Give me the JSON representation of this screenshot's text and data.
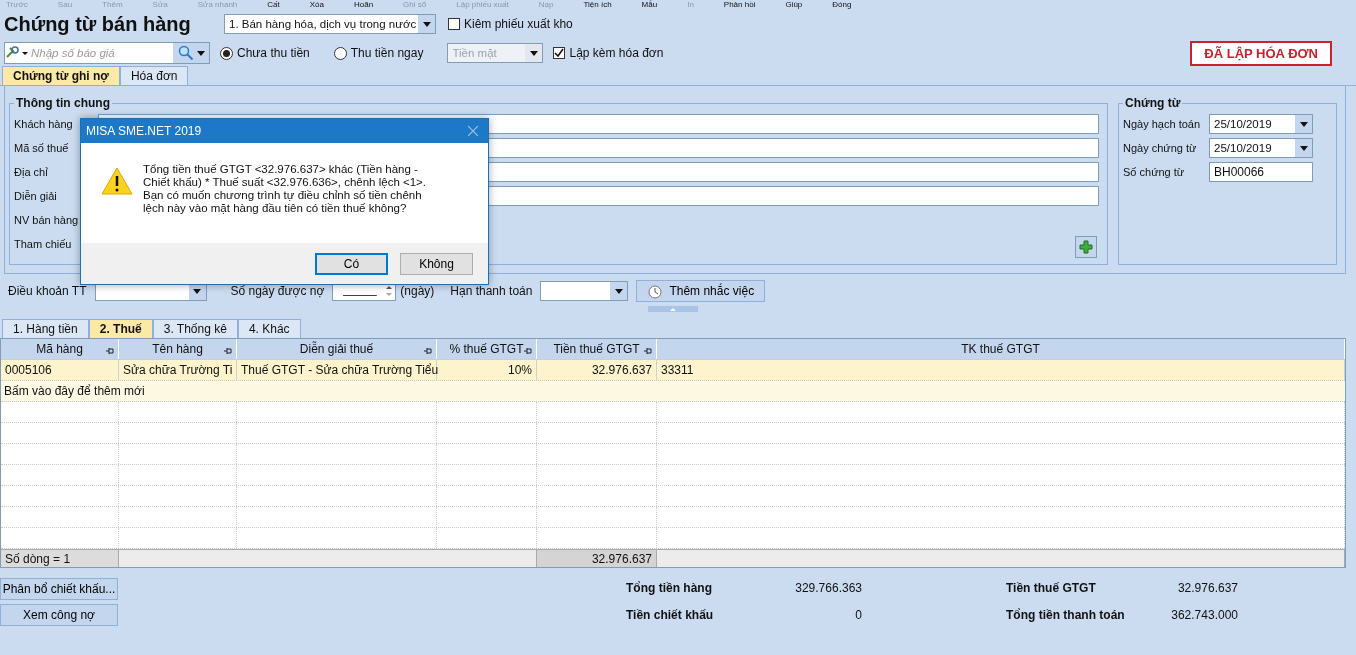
{
  "toolbar": [
    {
      "label": "Trước",
      "disabled": true
    },
    {
      "label": "Sau",
      "disabled": true
    },
    {
      "label": "Thêm",
      "disabled": true
    },
    {
      "label": "Sửa",
      "disabled": true
    },
    {
      "label": "Sửa nhanh",
      "disabled": true
    },
    {
      "label": "Cất",
      "disabled": false
    },
    {
      "label": "Xóa",
      "disabled": false
    },
    {
      "label": "Hoãn",
      "disabled": false
    },
    {
      "label": "Ghi sổ",
      "disabled": true
    },
    {
      "label": "Lập phiếu xuất",
      "disabled": true
    },
    {
      "label": "Nạp",
      "disabled": true
    },
    {
      "label": "Tiện ích",
      "disabled": false
    },
    {
      "label": "Mẫu",
      "disabled": false
    },
    {
      "label": "In",
      "disabled": true
    },
    {
      "label": "Phản hồi",
      "disabled": false
    },
    {
      "label": "Giúp",
      "disabled": false
    },
    {
      "label": "Đóng",
      "disabled": false
    }
  ],
  "title": "Chứng từ bán hàng",
  "sale_type": {
    "value": "1. Bán hàng hóa, dịch vụ trong nước"
  },
  "export_checkbox": {
    "label": "Kiêm phiếu xuất kho",
    "checked": false
  },
  "stamp": "ĐÃ LẬP HÓA ĐƠN",
  "quote_search": {
    "placeholder": "Nhập số báo giá"
  },
  "payment_options": [
    {
      "label": "Chưa thu tiền",
      "selected": true
    },
    {
      "label": "Thu tiền ngay",
      "selected": false
    }
  ],
  "payment_method": {
    "value": "Tiền mặt",
    "disabled": true
  },
  "invoice_checkbox": {
    "label": "Lập kèm hóa đơn",
    "checked": true
  },
  "tabs": [
    {
      "label": "Chứng từ ghi nợ",
      "selected": true
    },
    {
      "label": "Hóa đơn",
      "selected": false
    }
  ],
  "general_info": {
    "title": "Thông tin chung",
    "fields": [
      {
        "label": "Khách hàng",
        "kind": "input"
      },
      {
        "label": "Mã số thuế",
        "kind": "input"
      },
      {
        "label": "Địa chỉ",
        "kind": "input"
      },
      {
        "label": "Diễn giải",
        "kind": "input"
      },
      {
        "label": "NV bán hàng",
        "kind": "none"
      },
      {
        "label": "Tham chiếu",
        "kind": "none"
      }
    ]
  },
  "voucher": {
    "title": "Chứng từ",
    "fields": [
      {
        "label": "Ngày hạch toán",
        "value": "25/10/2019",
        "kind": "combo"
      },
      {
        "label": "Ngày chứng từ",
        "value": "25/10/2019",
        "kind": "combo"
      },
      {
        "label": "Số chứng từ",
        "value": "BH00066",
        "kind": "input"
      }
    ]
  },
  "terms": {
    "payment_terms_label": "Điều khoản TT",
    "days_label": "Số ngày được nợ",
    "days_value": "_____",
    "days_unit": "(ngày)",
    "due_label": "Hạn thanh toán",
    "reminder_button": "Thêm nhắc việc"
  },
  "grid_tabs": [
    {
      "label": "1. Hàng tiền",
      "selected": false
    },
    {
      "label": "2. Thuế",
      "selected": true
    },
    {
      "label": "3. Thống kê",
      "selected": false
    },
    {
      "label": "4. Khác",
      "selected": false
    }
  ],
  "table": {
    "columns": [
      "Mã hàng",
      "Tên hàng",
      "Diễn giải thuế",
      "% thuế GTGT",
      "Tiền thuế GTGT",
      "TK thuế GTGT"
    ],
    "rows": [
      [
        "0005106",
        "Sửa  chữa Trường Ti",
        "Thuế GTGT - Sửa  chữa Trường Tiểu",
        "10%",
        "32.976.637",
        "33311"
      ]
    ],
    "new_row_hint": "Bấm vào đây để thêm mới",
    "footer": {
      "count": "Số dòng = 1",
      "tax_total": "32.976.637"
    }
  },
  "buttons": [
    "Phân bổ chiết khấu...",
    "Xem công nợ"
  ],
  "totals": [
    {
      "label": "Tổng tiền hàng",
      "value": "329.766.363"
    },
    {
      "label": "Tiền chiết khấu",
      "value": "0"
    },
    {
      "label": "Tiền thuế GTGT",
      "value": "32.976.637"
    },
    {
      "label": "Tổng tiền thanh toán",
      "value": "362.743.000"
    }
  ],
  "dialog": {
    "title": "MISA SME.NET 2019",
    "message": "Tổng tiền thuế GTGT <32.976.637> khác (Tiền hàng - Chiết khấu) * Thuế suất <32.976.636>, chênh lệch <1>. Bạn có muốn chương trình tự điều chỉnh số tiền chênh lệch này vào mặt hàng đầu tiên có tiền thuế không?",
    "buttons": [
      {
        "label": "Có",
        "selected": true
      },
      {
        "label": "Không",
        "selected": false
      }
    ]
  }
}
